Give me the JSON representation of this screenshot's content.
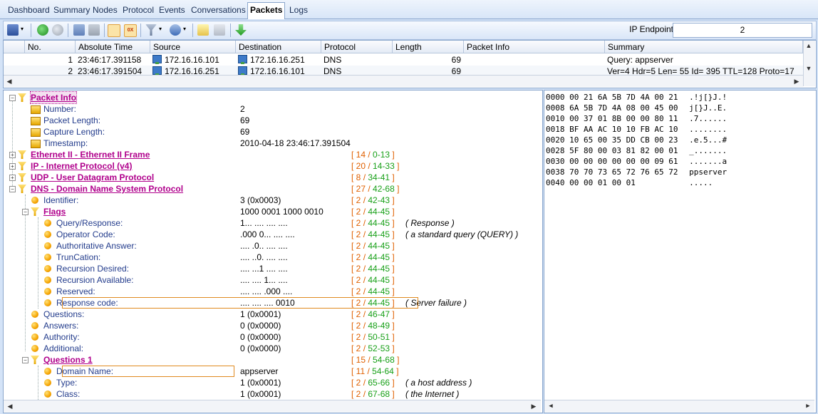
{
  "tabs": [
    {
      "label": "Dashboard",
      "active": false
    },
    {
      "label": "Summary",
      "active": false
    },
    {
      "label": "Nodes",
      "active": false
    },
    {
      "label": "Protocol",
      "active": false
    },
    {
      "label": "Events",
      "active": false
    },
    {
      "label": "Conversations",
      "active": false
    },
    {
      "label": "Packets",
      "active": true
    },
    {
      "label": "Logs",
      "active": false
    }
  ],
  "toolbar": {
    "ip_endpoint_label": "IP Endpoint",
    "ip_endpoint_value": "2",
    "icons": [
      "save-icon",
      "back-icon",
      "forward-icon",
      "layout-icon",
      "layout2-icon",
      "tree-icon",
      "hex-icon",
      "filter-icon",
      "pattern-icon",
      "edit-icon",
      "delete-icon",
      "download-icon"
    ]
  },
  "packet_list": {
    "columns": [
      "No.",
      "Absolute Time",
      "Source",
      "Destination",
      "Protocol",
      "Length",
      "Packet Info",
      "Summary"
    ],
    "rows": [
      {
        "no": "1",
        "time": "23:46:17.391158",
        "source": "172.16.16.101",
        "destination": "172.16.16.251",
        "protocol": "DNS",
        "length": "69",
        "info": "",
        "summary": "Query: appserver"
      },
      {
        "no": "2",
        "time": "23:46:17.391504",
        "source": "172.16.16.251",
        "destination": "172.16.16.101",
        "protocol": "DNS",
        "length": "69",
        "info": "",
        "summary": "Ver=4 Hdr=5 Len= 55 Id= 395 TTL=128 Proto=17"
      }
    ]
  },
  "tree": [
    {
      "label": "Packet Info",
      "type": "hdr",
      "value": "",
      "range_a": "",
      "range_b": "",
      "note": ""
    },
    {
      "label": "Number:",
      "type": "field",
      "value": "2",
      "range_a": "",
      "range_b": "",
      "note": ""
    },
    {
      "label": "Packet Length:",
      "type": "field",
      "value": "69",
      "range_a": "",
      "range_b": "",
      "note": ""
    },
    {
      "label": "Capture Length:",
      "type": "field",
      "value": "69",
      "range_a": "",
      "range_b": "",
      "note": ""
    },
    {
      "label": "Timestamp:",
      "type": "field",
      "value": "2010-04-18 23:46:17.391504",
      "range_a": "",
      "range_b": "",
      "note": ""
    },
    {
      "label": "Ethernet II - Ethernet II Frame",
      "type": "hdr",
      "value": "",
      "range_a": "14",
      "range_b": "0-13",
      "note": ""
    },
    {
      "label": "IP - Internet Protocol (v4)",
      "type": "hdr",
      "value": "",
      "range_a": "20",
      "range_b": "14-33",
      "note": ""
    },
    {
      "label": "UDP - User Datagram Protocol",
      "type": "hdr",
      "value": "",
      "range_a": "8",
      "range_b": "34-41",
      "note": ""
    },
    {
      "label": "DNS - Domain Name System Protocol",
      "type": "hdr",
      "value": "",
      "range_a": "27",
      "range_b": "42-68",
      "note": ""
    },
    {
      "label": "Identifier:",
      "type": "leaf",
      "value": "3 (0x0003)",
      "range_a": "2",
      "range_b": "42-43",
      "note": ""
    },
    {
      "label": "Flags",
      "type": "hdr",
      "value": "1000 0001 1000 0010",
      "range_a": "2",
      "range_b": "44-45",
      "note": ""
    },
    {
      "label": "Query/Response:",
      "type": "leaf",
      "value": "1... .... .... ....",
      "range_a": "2",
      "range_b": "44-45",
      "note": "( Response )"
    },
    {
      "label": "Operator Code:",
      "type": "leaf",
      "value": ".000 0... .... ....",
      "range_a": "2",
      "range_b": "44-45",
      "note": "( a standard query (QUERY) )"
    },
    {
      "label": "Authoritative Answer:",
      "type": "leaf",
      "value": ".... .0.. .... ....",
      "range_a": "2",
      "range_b": "44-45",
      "note": ""
    },
    {
      "label": "TrunCation:",
      "type": "leaf",
      "value": ".... ..0. .... ....",
      "range_a": "2",
      "range_b": "44-45",
      "note": ""
    },
    {
      "label": "Recursion Desired:",
      "type": "leaf",
      "value": ".... ...1 .... ....",
      "range_a": "2",
      "range_b": "44-45",
      "note": ""
    },
    {
      "label": "Recursion Available:",
      "type": "leaf",
      "value": ".... .... 1... ....",
      "range_a": "2",
      "range_b": "44-45",
      "note": ""
    },
    {
      "label": "Reserved:",
      "type": "leaf",
      "value": ".... .... .000 ....",
      "range_a": "2",
      "range_b": "44-45",
      "note": ""
    },
    {
      "label": "Response code:",
      "type": "leaf",
      "value": ".... .... .... 0010",
      "range_a": "2",
      "range_b": "44-45",
      "note": "( Server failure )"
    },
    {
      "label": "Questions:",
      "type": "leaf",
      "value": "1 (0x0001)",
      "range_a": "2",
      "range_b": "46-47",
      "note": ""
    },
    {
      "label": "Answers:",
      "type": "leaf",
      "value": "0 (0x0000)",
      "range_a": "2",
      "range_b": "48-49",
      "note": ""
    },
    {
      "label": "Authority:",
      "type": "leaf",
      "value": "0 (0x0000)",
      "range_a": "2",
      "range_b": "50-51",
      "note": ""
    },
    {
      "label": "Additional:",
      "type": "leaf",
      "value": "0 (0x0000)",
      "range_a": "2",
      "range_b": "52-53",
      "note": ""
    },
    {
      "label": "Questions 1",
      "type": "hdr",
      "value": "",
      "range_a": "15",
      "range_b": "54-68",
      "note": ""
    },
    {
      "label": "Domain Name:",
      "type": "leaf",
      "value": "appserver",
      "range_a": "11",
      "range_b": "54-64",
      "note": ""
    },
    {
      "label": "Type:",
      "type": "leaf",
      "value": "1 (0x0001)",
      "range_a": "2",
      "range_b": "65-66",
      "note": "( a host address )"
    },
    {
      "label": "Class:",
      "type": "leaf",
      "value": "1 (0x0001)",
      "range_a": "2",
      "range_b": "67-68",
      "note": "( the Internet )"
    }
  ],
  "hex_dump": [
    {
      "offset": "0000",
      "bytes": "00 21 6A 5B 7D 4A 00 21",
      "ascii": ".!j[}J.!"
    },
    {
      "offset": "0008",
      "bytes": "6A 5B 7D 4A 08 00 45 00",
      "ascii": "j[}J..E."
    },
    {
      "offset": "0010",
      "bytes": "00 37 01 8B 00 00 80 11",
      "ascii": ".7......"
    },
    {
      "offset": "0018",
      "bytes": "BF AA AC 10 10 FB AC 10",
      "ascii": "........"
    },
    {
      "offset": "0020",
      "bytes": "10 65 00 35 DD CB 00 23",
      "ascii": ".e.5...#"
    },
    {
      "offset": "0028",
      "bytes": "5F 80 00 03 81 82 00 01",
      "ascii": "_......."
    },
    {
      "offset": "0030",
      "bytes": "00 00 00 00 00 00 09 61",
      "ascii": ".......a"
    },
    {
      "offset": "0038",
      "bytes": "70 70 73 65 72 76 65 72",
      "ascii": "ppserver"
    },
    {
      "offset": "0040",
      "bytes": "00 00 01 00 01",
      "ascii": "....."
    }
  ],
  "colors": {
    "header": "#b0008c",
    "leaf": "#233c8c",
    "range_size": "#e06000",
    "range_span": "#18a018",
    "highlight": "#e08a20"
  }
}
